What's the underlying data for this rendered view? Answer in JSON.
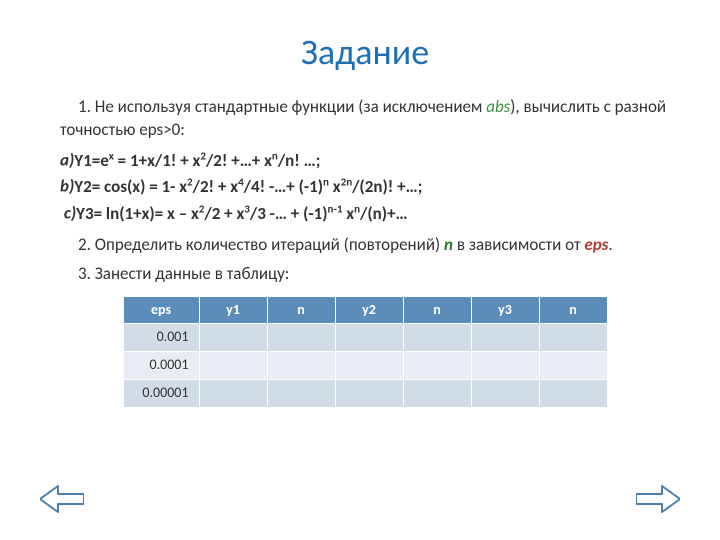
{
  "title": "Задание",
  "para1_a": "1. Не используя стандартные функции (за исключением ",
  "para1_abs": "abs",
  "para1_b": "), вычислить с разной точностью eps>0:",
  "formula_a_label": "a)",
  "formula_a_body_html": "Y1=e<span class='sup'>x</span> = 1+x/1! + x<span class='sup'>2</span>/2! +…+ x<span class='sup'>n</span>/n! …;",
  "formula_b_label": "b)",
  "formula_b_body_html": "Y2= cos(x) = 1- x<span class='sup'>2</span>/2! + x<span class='sup'>4</span>/4! -…+ (-1)<span class='sup'>n</span> x<span class='sup'>2n</span>/(2n)! +…;",
  "formula_c_label": "c)",
  "formula_c_body_html": "Y3= ln(1+x)= x – x<span class='sup'>2</span>/2 + x<span class='sup'>3</span>/3 -… + (-1)<span class='sup'>n-1</span> x<span class='sup'>n</span>/(n)+…",
  "para2_a": "2. Определить количество итераций (повторений) ",
  "para2_n": "n",
  "para2_b": " в зависимости от ",
  "para2_eps": "eps",
  "para2_c": ".",
  "para3": "3. Занести данные в таблицу:",
  "table": {
    "headers": [
      "eps",
      "y1",
      "n",
      "y2",
      "n",
      "y3",
      "n"
    ],
    "rows": [
      {
        "eps": "0.001",
        "y1": "",
        "n1": "",
        "y2": "",
        "n2": "",
        "y3": "",
        "n3": ""
      },
      {
        "eps": "0.0001",
        "y1": "",
        "n1": "",
        "y2": "",
        "n2": "",
        "y3": "",
        "n3": ""
      },
      {
        "eps": "0.00001",
        "y1": "",
        "n1": "",
        "y2": "",
        "n2": "",
        "y3": "",
        "n3": ""
      }
    ]
  },
  "icons": {
    "prev": "prev-arrow",
    "next": "next-arrow"
  }
}
